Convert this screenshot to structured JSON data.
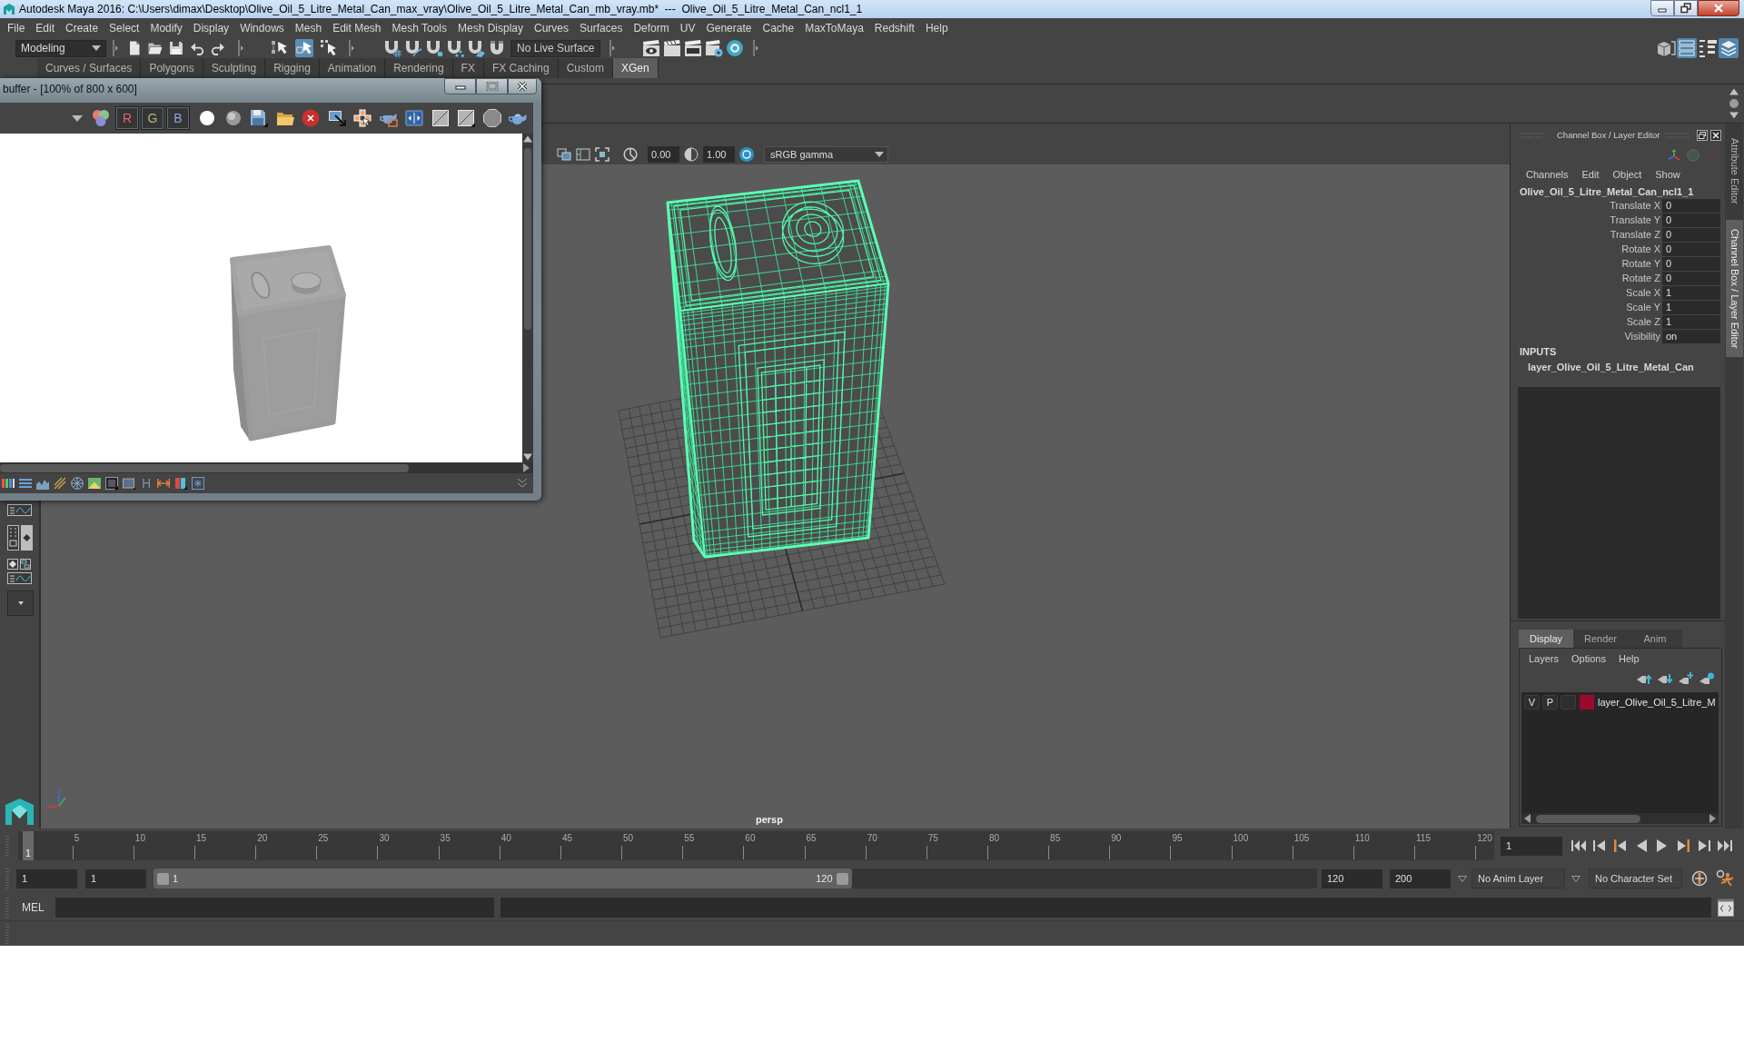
{
  "window": {
    "title": "Autodesk Maya 2016: C:\\Users\\dimax\\Desktop\\Olive_Oil_5_Litre_Metal_Can_max_vray\\Olive_Oil_5_Litre_Metal_Can_mb_vray.mb*  ---  Olive_Oil_5_Litre_Metal_Can_ncl1_1"
  },
  "menu_bar": [
    "File",
    "Edit",
    "Create",
    "Select",
    "Modify",
    "Display",
    "Windows",
    "Mesh",
    "Edit Mesh",
    "Mesh Tools",
    "Mesh Display",
    "Curves",
    "Surfaces",
    "Deform",
    "UV",
    "Generate",
    "Cache",
    "MaxToMaya",
    "Redshift",
    "Help"
  ],
  "status_line": {
    "menu_set": "Modeling",
    "live_surface": "No Live Surface"
  },
  "shelf": {
    "tabs": [
      {
        "label": "Curves / Surfaces",
        "selected": false
      },
      {
        "label": "Polygons",
        "selected": false
      },
      {
        "label": "Sculpting",
        "selected": false
      },
      {
        "label": "Rigging",
        "selected": false
      },
      {
        "label": "Animation",
        "selected": false
      },
      {
        "label": "Rendering",
        "selected": false
      },
      {
        "label": "FX",
        "selected": false
      },
      {
        "label": "FX Caching",
        "selected": false
      },
      {
        "label": "Custom",
        "selected": false
      },
      {
        "label": "XGen",
        "selected": true
      }
    ]
  },
  "render_window": {
    "title": "buffer - [100% of 800 x 600]",
    "channel_buttons": [
      {
        "label": "R",
        "color": "#e86464"
      },
      {
        "label": "G",
        "color": "#a6bf6e"
      },
      {
        "label": "B",
        "color": "#86a9e0"
      }
    ],
    "footer_label": "H"
  },
  "viewport": {
    "exposure": "0.00",
    "gamma": "1.00",
    "view_transform": "sRGB gamma",
    "camera": "persp"
  },
  "channel_box": {
    "title": "Channel Box / Layer Editor",
    "menus": [
      "Channels",
      "Edit",
      "Object",
      "Show"
    ],
    "object": "Olive_Oil_5_Litre_Metal_Can_ncl1_1",
    "attributes": [
      {
        "name": "Translate X",
        "value": "0"
      },
      {
        "name": "Translate Y",
        "value": "0"
      },
      {
        "name": "Translate Z",
        "value": "0"
      },
      {
        "name": "Rotate X",
        "value": "0"
      },
      {
        "name": "Rotate Y",
        "value": "0"
      },
      {
        "name": "Rotate Z",
        "value": "0"
      },
      {
        "name": "Scale X",
        "value": "1"
      },
      {
        "name": "Scale Y",
        "value": "1"
      },
      {
        "name": "Scale Z",
        "value": "1"
      },
      {
        "name": "Visibility",
        "value": "on"
      }
    ],
    "inputs_heading": "INPUTS",
    "inputs": [
      "layer_Olive_Oil_5_Litre_Metal_Can"
    ]
  },
  "side_tabs": [
    {
      "label": "Attribute Editor",
      "selected": false
    },
    {
      "label": "Channel Box / Layer Editor",
      "selected": true
    }
  ],
  "layer_editor": {
    "tabs": [
      {
        "label": "Display",
        "selected": true
      },
      {
        "label": "Render",
        "selected": false
      },
      {
        "label": "Anim",
        "selected": false
      }
    ],
    "menus": [
      "Layers",
      "Options",
      "Help"
    ],
    "layers": [
      {
        "visibility": "V",
        "playback": "P",
        "color": "#9a0a2c",
        "name": "layer_Olive_Oil_5_Litre_M"
      }
    ]
  },
  "time_slider": {
    "labels": [
      "5",
      "10",
      "15",
      "20",
      "25",
      "30",
      "35",
      "40",
      "45",
      "50",
      "55",
      "60",
      "65",
      "70",
      "75",
      "80",
      "85",
      "90",
      "95",
      "100",
      "105",
      "110",
      "115",
      "120"
    ],
    "current_frame_marker": "1",
    "level": 0,
    "current_frame": "1"
  },
  "range_slider": {
    "animation_start": "1",
    "playback_start": "1",
    "bar_start": "1",
    "bar_end": "120",
    "level": 0.6,
    "playback_end": "120",
    "animation_end": "200",
    "anim_layer": "No Anim Layer",
    "character_set": "No Character Set"
  },
  "command_line": {
    "language": "MEL"
  }
}
